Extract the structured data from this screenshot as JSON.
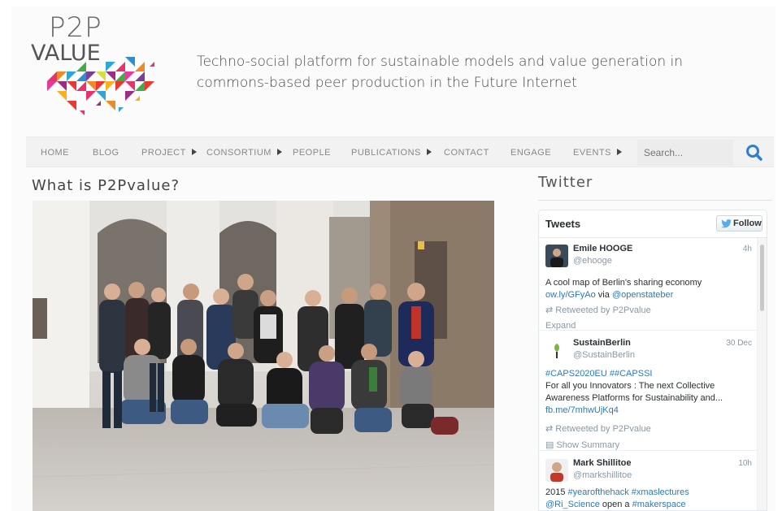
{
  "header": {
    "logo_line1": "P2P",
    "logo_line2": "VALUE",
    "tagline": "Techno-social platform for sustainable models and value generation in commons-based peer production in the Future Internet"
  },
  "nav": {
    "items": [
      {
        "label": "HOME",
        "has_submenu": false
      },
      {
        "label": "BLOG",
        "has_submenu": false
      },
      {
        "label": "PROJECT",
        "has_submenu": true
      },
      {
        "label": "CONSORTIUM",
        "has_submenu": true
      },
      {
        "label": "PEOPLE",
        "has_submenu": false
      },
      {
        "label": "PUBLICATIONS",
        "has_submenu": true
      },
      {
        "label": "CONTACT",
        "has_submenu": false
      },
      {
        "label": "ENGAGE",
        "has_submenu": false
      },
      {
        "label": "EVENTS",
        "has_submenu": true
      }
    ],
    "search_placeholder": "Search...",
    "search_icon": "search-icon",
    "accent_color": "#2e7fd0"
  },
  "main": {
    "title": "What is P2Pvalue?",
    "image": "group-photo"
  },
  "sidebar": {
    "title": "Twitter",
    "widget": {
      "heading": "Tweets",
      "follow_label": "Follow",
      "tweets": [
        {
          "name": "Emile HOOGE",
          "handle": "@ehooge",
          "time": "4h",
          "text": "A cool map of Berlin's sharing economy",
          "link_line": "ow.ly/GFyAo",
          "via": " via ",
          "mention": "@openstateber",
          "retweeted": "Retweeted by P2Pvalue",
          "action": "Expand"
        },
        {
          "name": "SustainBerlin",
          "handle": "@SustainBerlin",
          "time": "30 Dec",
          "hashtags": "#CAPS2020EU  ##CAPSSI",
          "text_line1": "For all you Innovators : The next Collective",
          "text_line2": "Awareness Platforms for Sustainability and...",
          "link_line": "fb.me/7mhwUjKq4",
          "retweeted": "Retweeted by P2Pvalue",
          "action": "Show Summary"
        },
        {
          "name": "Mark Shillitoe",
          "handle": "@markshillitoe",
          "time": "10h",
          "line1_prefix": "2015 ",
          "line1_tags": "#yearofthehack #xmaslectures",
          "line2_mention": "@Ri_Science",
          "line2_mid": " open a ",
          "line2_tag": "#makerspace"
        }
      ]
    }
  }
}
